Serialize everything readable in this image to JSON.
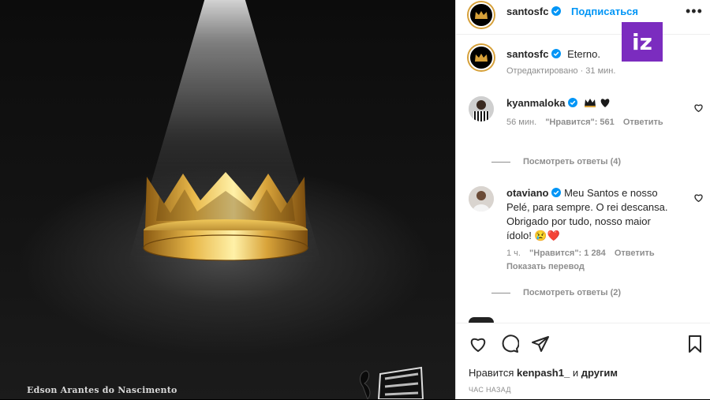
{
  "photo": {
    "caption": "Edson Arantes do Nascimento"
  },
  "header": {
    "username": "santosfc",
    "follow_label": "Подписаться",
    "more_label": "•••"
  },
  "watermark": {
    "text": "iz"
  },
  "post_caption": {
    "username": "santosfc",
    "text": "Eterno.",
    "meta": "Отредактировано · 31 мин."
  },
  "comments": [
    {
      "username": "kyanmaloka",
      "text": "",
      "time": "56 мин.",
      "likes": "\"Нравится\": 561",
      "reply": "Ответить",
      "view_replies": "Посмотреть ответы (4)"
    },
    {
      "username": "otaviano",
      "text": "Meu Santos e nosso Pelé, para sempre. O rei descansa. Obrigado por tudo, nosso maior ídolo! 😢❤️",
      "time": "1 ч.",
      "likes": "\"Нравится\": 1 284",
      "reply": "Ответить",
      "translate": "Показать перевод",
      "view_replies": "Посмотреть ответы (2)"
    }
  ],
  "actions": {
    "likes_prefix": "Нравится",
    "likes_user": "kenpash1_",
    "likes_and": "и",
    "likes_others": "другим",
    "timestamp": "ЧАС НАЗАД"
  },
  "colors": {
    "accent": "#0095f6",
    "muted": "#8e8e8e",
    "watermark": "#7b2cbf",
    "gold": "#d6a039"
  }
}
